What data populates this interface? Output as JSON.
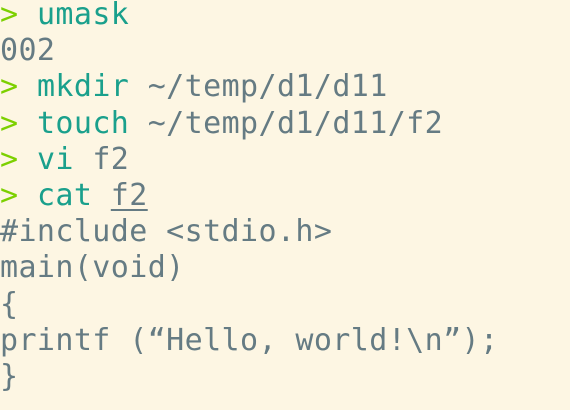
{
  "prompt_symbol": ">",
  "colors": {
    "background": "#fdf6e3",
    "prompt": "#7cd000",
    "command": "#1aa08c",
    "text": "#657b83"
  },
  "lines": [
    {
      "type": "command",
      "cmd": "umask",
      "args": ""
    },
    {
      "type": "output",
      "text": "002"
    },
    {
      "type": "command",
      "cmd": "mkdir",
      "args": "~/temp/d1/d11"
    },
    {
      "type": "command",
      "cmd": "touch",
      "args": "~/temp/d1/d11/f2"
    },
    {
      "type": "command",
      "cmd": "vi",
      "args": "f2"
    },
    {
      "type": "command",
      "cmd": "cat",
      "args": "f2"
    },
    {
      "type": "output",
      "text": "#include <stdio.h>"
    },
    {
      "type": "output",
      "text": "main(void)"
    },
    {
      "type": "output",
      "text": "{"
    },
    {
      "type": "output",
      "text": "printf (“Hello, world!\\n”);"
    },
    {
      "type": "output",
      "text": "}"
    }
  ]
}
